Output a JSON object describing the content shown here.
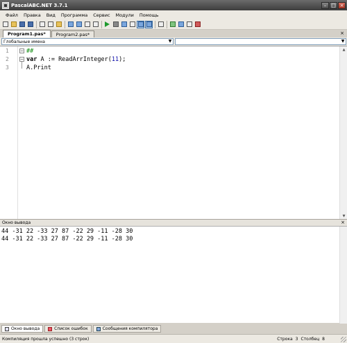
{
  "window": {
    "title": "PascalABC.NET 3.7.1"
  },
  "menu": [
    "Файл",
    "Правка",
    "Вид",
    "Программа",
    "Сервис",
    "Модули",
    "Помощь"
  ],
  "toolbar": {
    "icons": [
      "new-file-icon",
      "open-folder-icon",
      "save-icon",
      "save-all-icon",
      "cut-icon",
      "copy-icon",
      "paste-icon",
      "undo-icon",
      "redo-icon",
      "find-icon",
      "replace-icon",
      "run-icon",
      "stop-icon",
      "step-icon",
      "compile-icon",
      "layout-output-icon",
      "layout-split-icon",
      "format-icon",
      "module-icon",
      "form-designer-icon",
      "window-cascade-icon",
      "window-tile-icon"
    ]
  },
  "tabs": [
    {
      "label": "Program1.pas*",
      "active": true
    },
    {
      "label": "Program2.pas*",
      "active": false
    }
  ],
  "navigator": {
    "scope": "Глобальные имена",
    "member": ""
  },
  "editor": {
    "lines": [
      {
        "num": "1",
        "text": "##"
      },
      {
        "num": "2",
        "kw": "var",
        "text": " A := ReadArrInteger(",
        "arg": "11",
        "tail": ");"
      },
      {
        "num": "3",
        "text": "A.Print"
      }
    ]
  },
  "output": {
    "title": "Окно вывода",
    "lines": [
      "44 -31 22 -33 27 87 -22 29 -11 -28 30",
      "44 -31 22 -33 27 87 -22 29 -11 -28 30"
    ]
  },
  "bottom_tabs": [
    {
      "label": "Окно вывода",
      "icon": "output-window-icon",
      "active": true
    },
    {
      "label": "Список ошибок",
      "icon": "error-list-icon",
      "active": false
    },
    {
      "label": "Сообщения компилятора",
      "icon": "compiler-messages-icon",
      "active": false
    }
  ],
  "status": {
    "message": "Компиляция прошла успешно (3 строк)",
    "row_label": "Строка",
    "row": "3",
    "col_label": "Столбец",
    "col": "8"
  }
}
